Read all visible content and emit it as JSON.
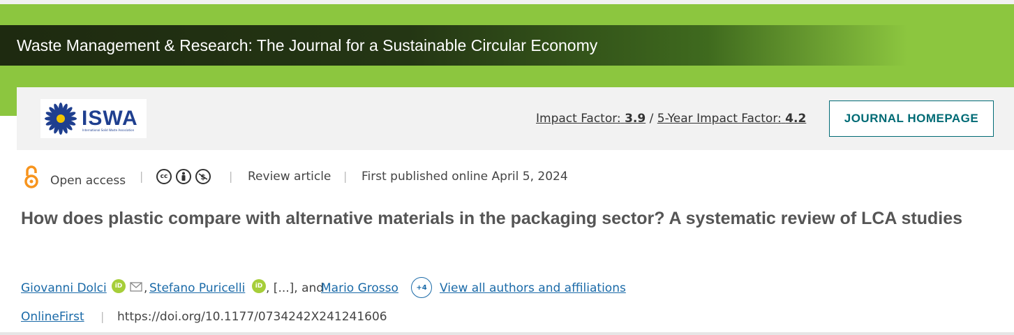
{
  "header": {
    "journal_title": "Waste Management & Research: The Journal for a Sustainable Circular Economy",
    "logo_text": "ISWA",
    "logo_subtext": "International Solid Waste Association",
    "impact_factor_label": "Impact Factor:",
    "impact_factor_value": "3.9",
    "separator": "/",
    "five_year_label": "5-Year Impact Factor:",
    "five_year_value": "4.2",
    "journal_homepage_label": "JOURNAL HOMEPAGE"
  },
  "article_meta": {
    "access": "Open access",
    "article_type": "Review article",
    "published": "First published online April 5, 2024",
    "license_icons": [
      "cc-icon",
      "by-icon",
      "nc-icon"
    ]
  },
  "article": {
    "title": "How does plastic compare with alternative materials in the packaging sector? A systematic review of LCA studies"
  },
  "authors": {
    "author_1": "Giovanni Dolci",
    "author_2": "Stefano Puricelli",
    "ellipsis": ", [...], and",
    "author_3": "Mario Grosso",
    "comma": ",",
    "more_count": "+4",
    "view_all": "View all authors and affiliations",
    "orcid_text": "iD"
  },
  "doi_row": {
    "online_first": "OnlineFirst",
    "doi": "https://doi.org/10.1177/0734242X241241606"
  },
  "colors": {
    "green": "#8cc63f",
    "dark_green": "#1e2a10",
    "link": "#1a6aa8",
    "teal": "#006b75",
    "open_access_orange": "#f7941d"
  }
}
